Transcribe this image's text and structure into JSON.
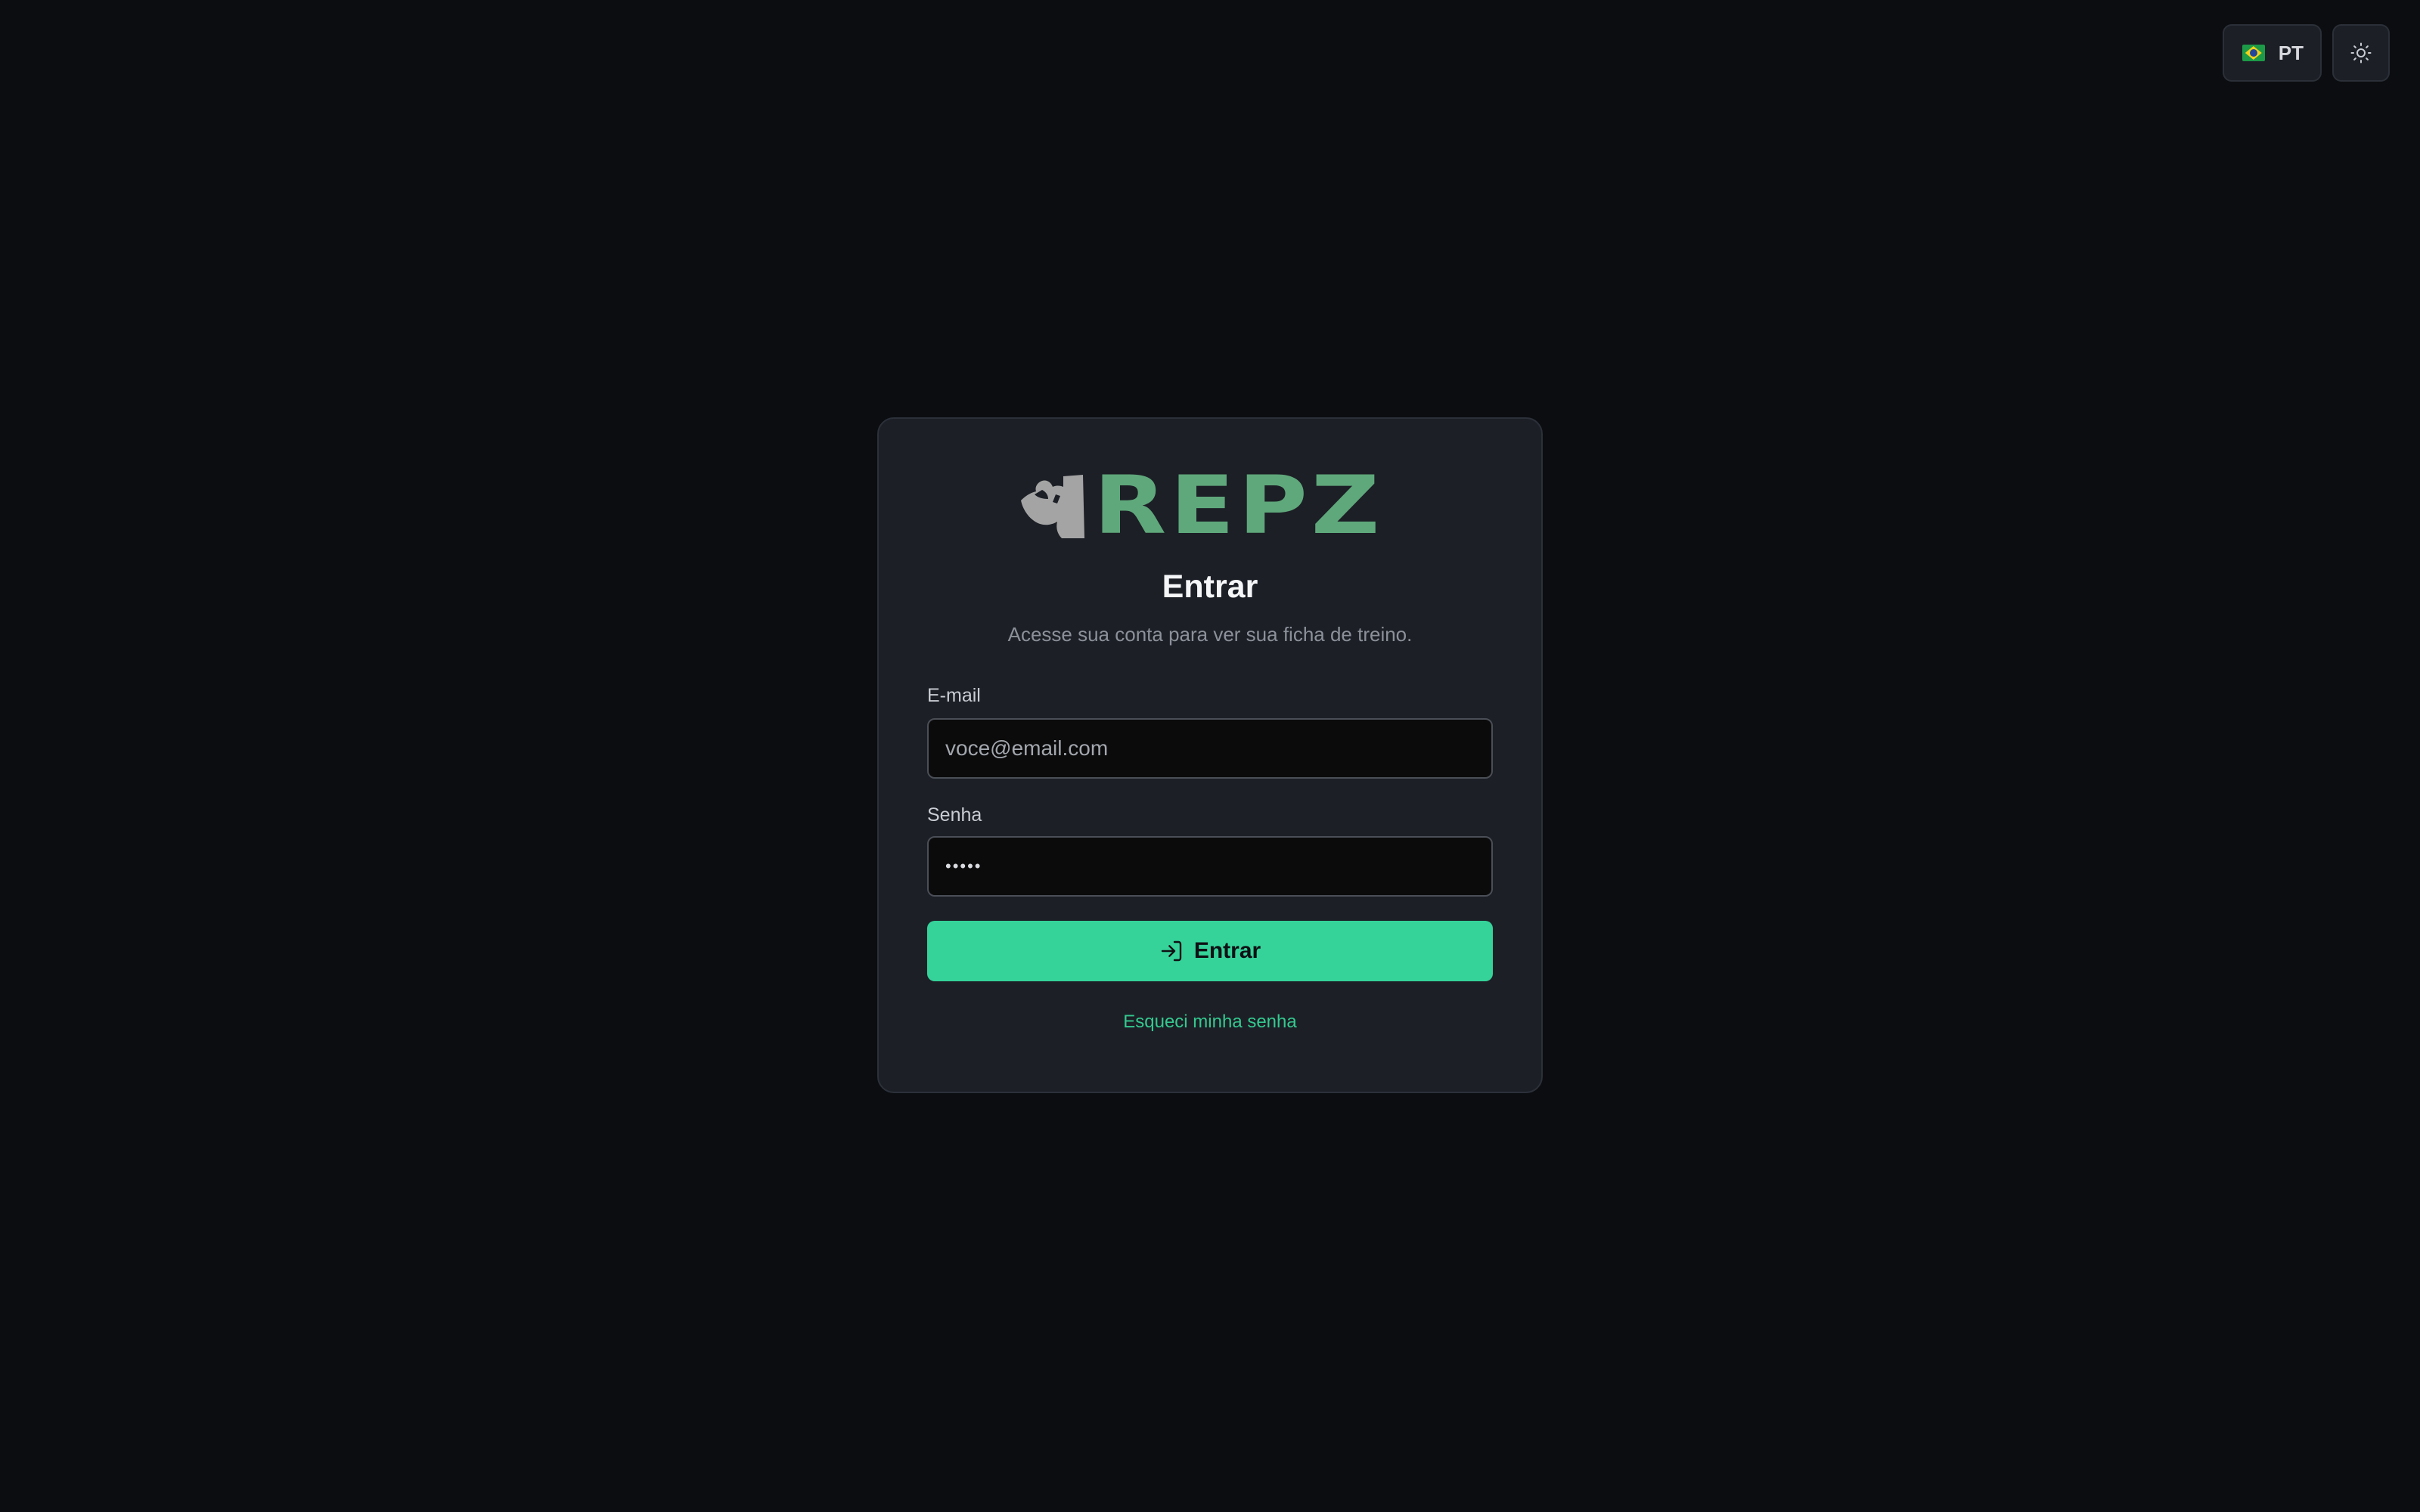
{
  "header": {
    "language": {
      "label": "PT",
      "flag_icon": "brazil-flag-icon"
    },
    "theme_toggle": {
      "icon": "sun-icon"
    }
  },
  "login": {
    "logo": {
      "text": "REPZ",
      "icon": "flexed-arm-icon",
      "color": "#5fa87b"
    },
    "title": "Entrar",
    "subtitle": "Acesse sua conta para ver sua ficha de treino.",
    "email": {
      "label": "E-mail",
      "placeholder": "voce@email.com",
      "value": ""
    },
    "password": {
      "label": "Senha",
      "masked_value": "•••••"
    },
    "submit": {
      "label": "Entrar",
      "icon": "log-in-icon"
    },
    "forgot_link": "Esqueci minha senha"
  },
  "colors": {
    "background": "#0b0d10",
    "card": "#1c1f26",
    "accent": "#35d39a",
    "link": "#34c98f"
  }
}
